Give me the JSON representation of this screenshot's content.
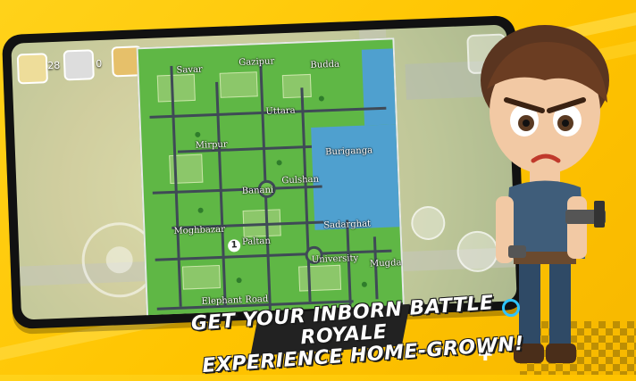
{
  "tagline": {
    "line1": "GET YOUR INBORN BATTLE ROYALE",
    "line2": "EXPERIENCE HOME-GROWN!"
  },
  "hud": {
    "left_count": "28",
    "right_count": "0"
  },
  "map": {
    "places": {
      "savar": "Savar",
      "gazipur": "Gazipur",
      "budda": "Budda",
      "uttara": "Uttara",
      "mirpur": "Mirpur",
      "buriganga": "Buriganga",
      "banani": "Banani",
      "gulshan": "Gulshan",
      "sadarghat": "Sadarghat",
      "moghbazar": "Moghbazar",
      "paltan": "Paltan",
      "university": "University",
      "mugda": "Mugda",
      "elephant_road": "Elephant Road"
    },
    "player_pin": "1"
  },
  "colors": {
    "background": "#ffc400",
    "map_green": "#5fb745",
    "water": "#4fa0cf",
    "accent_ring": "#2ec4ff"
  },
  "icons": {
    "player_marker": "player-marker-icon",
    "joystick": "joystick-icon",
    "sparkle": "sparkle-cross-icon"
  }
}
